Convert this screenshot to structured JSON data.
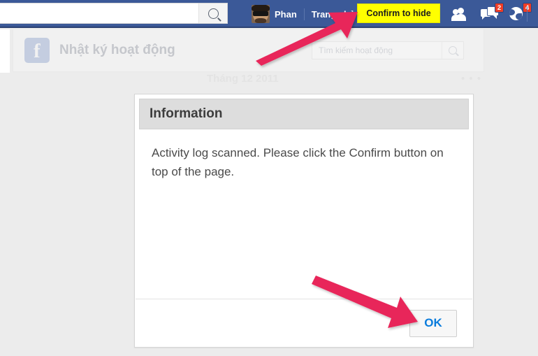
{
  "topbar": {
    "search": {
      "value": "",
      "placeholder": "",
      "icon": "search-icon"
    },
    "profile_name": "Phan",
    "home_link": "Trang chủ",
    "confirm_button": "Confirm to hide",
    "icons": [
      {
        "name": "friends-icon",
        "badge": ""
      },
      {
        "name": "messages-icon",
        "badge": "2"
      },
      {
        "name": "notifications-globe-icon",
        "badge": "4"
      }
    ],
    "colors": {
      "bar": "#3b5998",
      "confirm_bg": "#ffff00",
      "badge": "#f03d25"
    }
  },
  "activity_panel": {
    "logo": "facebook-logo-icon",
    "logo_glyph": "f",
    "title": "Nhật ký hoạt động",
    "search": {
      "value": "",
      "placeholder": "Tìm kiếm hoạt động",
      "icon": "search-icon"
    }
  },
  "timeline": {
    "month_label": "Tháng 12 2011",
    "dots": "• • •"
  },
  "dialog": {
    "title": "Information",
    "body_text": "Activity log scanned. Please click the Confirm button on top of the page.",
    "ok_button": "OK",
    "ok_color": "#0a7cdc"
  },
  "annotations": {
    "arrow_color": "#e8275a",
    "arrows": [
      {
        "name": "arrow-to-confirm-button",
        "points_to": "Confirm to hide"
      },
      {
        "name": "arrow-to-ok-button",
        "points_to": "OK"
      }
    ]
  }
}
